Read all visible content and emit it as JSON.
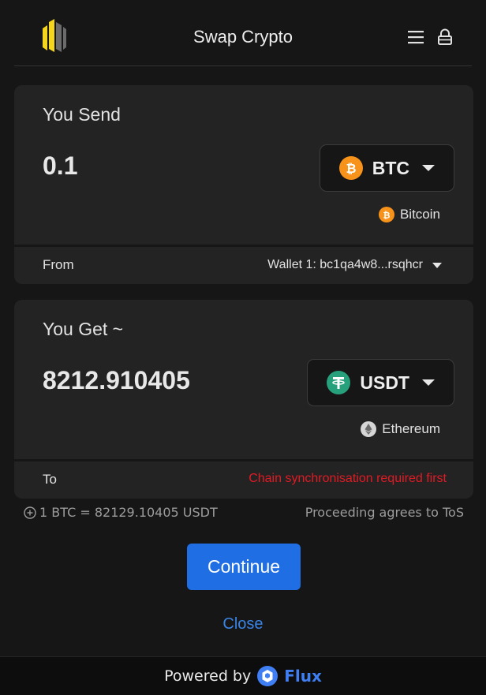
{
  "header": {
    "title": "Swap Crypto",
    "logo_icon": "logo-icon",
    "menu_icon": "menu-icon",
    "lock_icon": "lock-icon"
  },
  "send": {
    "label": "You Send",
    "amount": "0.1",
    "token": {
      "symbol": "BTC",
      "icon": "bitcoin-icon",
      "color": "#f7931a"
    },
    "network": {
      "name": "Bitcoin",
      "icon": "bitcoin-icon"
    },
    "from_label": "From",
    "wallet": "Wallet 1: bc1qa4w8...rsqhcr"
  },
  "get": {
    "label": "You Get ~",
    "amount": "8212.910405",
    "token": {
      "symbol": "USDT",
      "icon": "tether-icon",
      "color": "#26a17b"
    },
    "network": {
      "name": "Ethereum",
      "icon": "ethereum-icon"
    },
    "to_label": "To",
    "error": "Chain synchronisation required first"
  },
  "rate": "1 BTC = 82129.10405 USDT",
  "tos": "Proceeding agrees to ToS",
  "actions": {
    "continue": "Continue",
    "close": "Close"
  },
  "footer": {
    "powered_by": "Powered by",
    "brand": "Flux",
    "brand_color": "#3f7ff3"
  },
  "colors": {
    "background": "#161616",
    "card": "#232323",
    "accent": "#1f6ee3",
    "error": "#e01b24"
  }
}
